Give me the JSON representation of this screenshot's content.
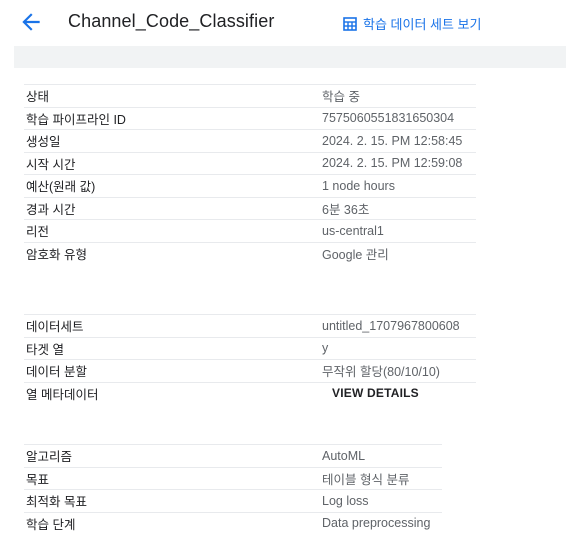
{
  "header": {
    "title": "Channel_Code_Classifier",
    "dataset_link": "학습 데이터 세트 보기"
  },
  "details": [
    {
      "label": "상태",
      "value": "학습 중"
    },
    {
      "label": "학습 파이프라인 ID",
      "value": "7575060551831650304"
    },
    {
      "label": "생성일",
      "value": "2024. 2. 15. PM 12:58:45"
    },
    {
      "label": "시작 시간",
      "value": "2024. 2. 15. PM 12:59:08"
    },
    {
      "label": "예산(원래 값)",
      "value": "1 node hours"
    },
    {
      "label": "경과 시간",
      "value": "6분 36초"
    },
    {
      "label": "리전",
      "value": "us-central1"
    },
    {
      "label": "암호화 유형",
      "value": "Google 관리"
    }
  ],
  "data": [
    {
      "label": "데이터세트",
      "value": "untitled_1707967800608"
    },
    {
      "label": "타겟 열",
      "value": "y"
    },
    {
      "label": "데이터 분할",
      "value": "무작위 할당(80/10/10)"
    },
    {
      "label": "열 메타데이터",
      "button": "VIEW DETAILS"
    }
  ],
  "algorithm": [
    {
      "label": "알고리즘",
      "value": "AutoML"
    },
    {
      "label": "목표",
      "value": "테이블 형식 분류"
    },
    {
      "label": "최적화 목표",
      "value": "Log loss"
    },
    {
      "label": "학습 단계",
      "value": "Data preprocessing"
    }
  ],
  "icons": {
    "back": "arrow-left-icon",
    "dataset": "table-grid-icon"
  },
  "colors": {
    "accent": "#1a73e8",
    "label": "#202124",
    "value": "#5f6368",
    "divider": "#e8eaed",
    "band": "#f1f3f4"
  }
}
